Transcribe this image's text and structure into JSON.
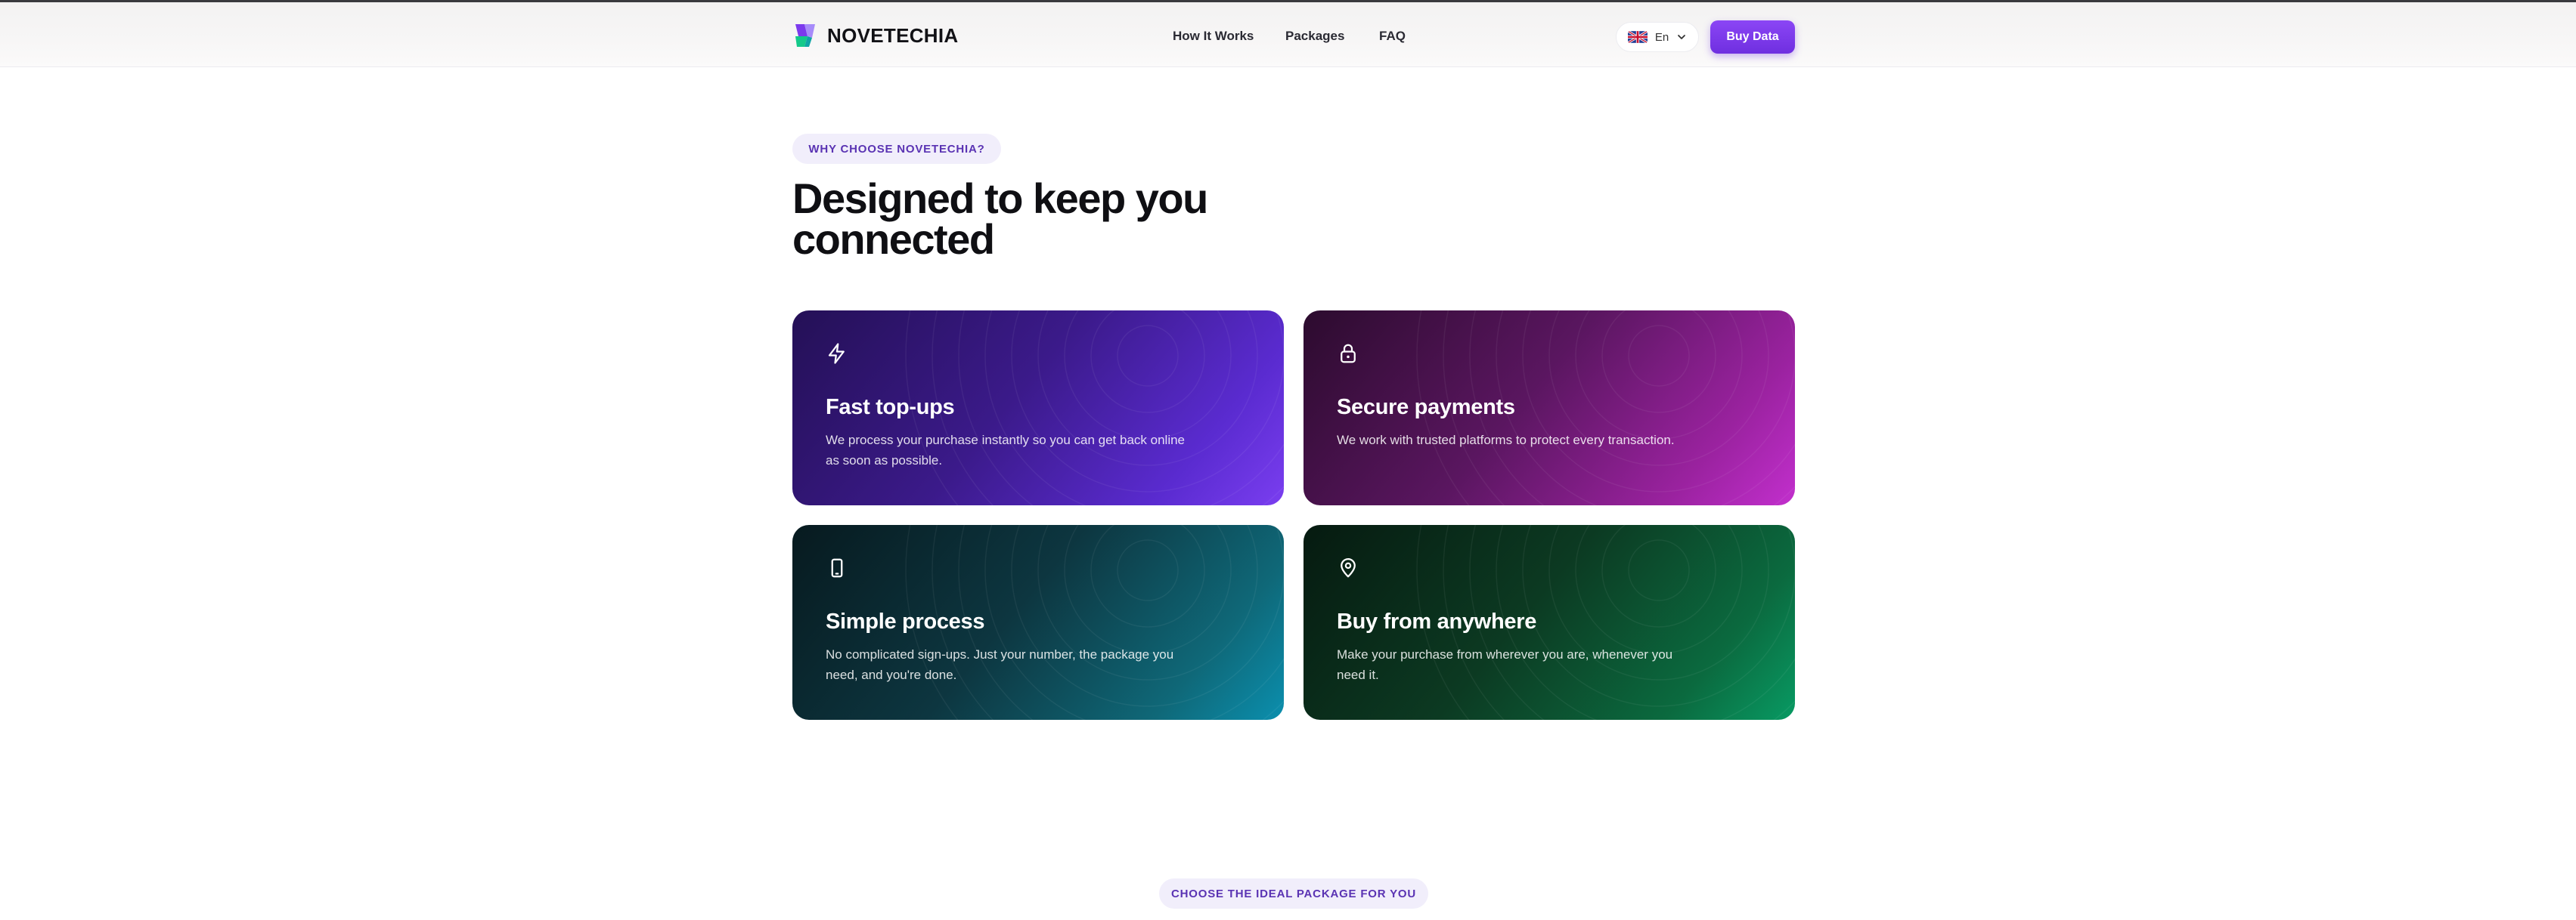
{
  "header": {
    "brand": "NOVETECHIA",
    "nav": [
      "How It Works",
      "Packages",
      "FAQ"
    ],
    "language": {
      "label": "En",
      "flag": "uk-flag-icon"
    },
    "cta": "Buy Data"
  },
  "features": {
    "eyebrow": "WHY CHOOSE NOVETECHIA?",
    "heading": "Designed to keep you connected",
    "cards": [
      {
        "icon": "lightning-icon",
        "title": "Fast top-ups",
        "description": "We process your purchase instantly so you can get back online as soon as possible."
      },
      {
        "icon": "lock-icon",
        "title": "Secure payments",
        "description": "We work with trusted platforms to protect every transaction."
      },
      {
        "icon": "smartphone-icon",
        "title": "Simple process",
        "description": "No complicated sign-ups. Just your number, the package you need, and you're done."
      },
      {
        "icon": "map-pin-icon",
        "title": "Buy from anywhere",
        "description": "Make your purchase from wherever you are, whenever you need it."
      }
    ]
  },
  "packages": {
    "eyebrow": "CHOOSE THE IDEAL PACKAGE FOR YOU"
  },
  "colors": {
    "accent": "#7c3aed",
    "card_fast": "#5a2bd0",
    "card_secure": "#c22fcd",
    "card_simple": "#0b8fae",
    "card_anywhere": "#089a63"
  }
}
